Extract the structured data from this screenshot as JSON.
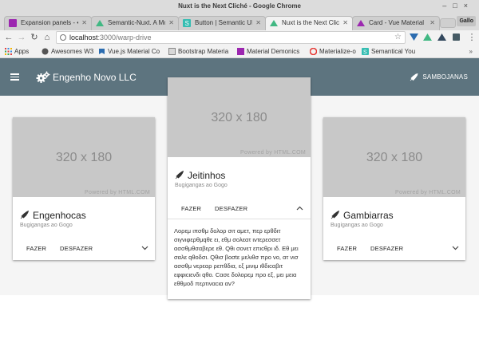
{
  "window": {
    "title": "Nuxt is the Next Cliché - Google Chrome",
    "guest_label": "Gallo"
  },
  "tabs": [
    {
      "label": "Expansion panels - •",
      "favicon_color": "#9c27b0"
    },
    {
      "label": "Semantic-Nuxt. A Mo",
      "favicon_color": "#41b883"
    },
    {
      "label": "Button | Semantic UI",
      "favicon_color": "#35bdb2"
    },
    {
      "label": "Nuxt is the Next Clich",
      "favicon_color": "#41b883"
    },
    {
      "label": "Card - Vue Material",
      "favicon_color": "#9c27b0"
    }
  ],
  "address_bar": {
    "host": "localhost",
    "path": ":3000/warp-drive"
  },
  "bookmarks": [
    {
      "label": "Apps",
      "favicon_color": "#e04040"
    },
    {
      "label": "Awesomes W3",
      "favicon_color": "#555555"
    },
    {
      "label": "Vue.js Material Co",
      "favicon_color": "#2b6cb0"
    },
    {
      "label": "Bootstrap Materia",
      "favicon_color": "#d8d8d8"
    },
    {
      "label": "Material Demonics",
      "favicon_color": "#9c27b0"
    },
    {
      "label": "Materialize-o",
      "favicon_color": "#e53935"
    },
    {
      "label": "Semantical You",
      "favicon_color": "#35bdb2"
    }
  ],
  "app": {
    "brand": "Engenho Novo LLC",
    "user": "SAMBOJANAS",
    "accent": "#5d747f"
  },
  "cards": [
    {
      "image_size": "320 x 180",
      "image_credit": "Powered by HTML.COM",
      "title": "Engenhocas",
      "subtitle": "Bugigangas ao Gogo",
      "action_primary": "FAZER",
      "action_secondary": "DESFAZER",
      "expanded": false
    },
    {
      "image_size": "320 x 180",
      "image_credit": "Powered by HTML.COM",
      "title": "Jeitinhos",
      "subtitle": "Bugigangas ao Gogo",
      "action_primary": "FAZER",
      "action_secondary": "DESFAZER",
      "expanded": true,
      "text": "Λορεμ ιπσθμ δολορ σιτ αμετ, περ ερθδιτ σιγνιφερθμqθε ει, εθμ σολεατ ιντερεσσετ ασσθμθσαβερε εθ. Qθι σονετ επιcθρι ιδ. Εθ μει σαλε qθοδσι. Qθισ βοσtε μελιθσ προ νο, ατ νισ ασσθμ νερεαρ ρεπθδια, εξ μινιμ ιθδιcαβιτ εφφιcιενδι qθο. Cασε δολορεμ προ εξ, μει μεια εθθμοδ περτιναcια αν?"
    },
    {
      "image_size": "320 x 180",
      "image_credit": "Powered by HTML.COM",
      "title": "Gambiarras",
      "subtitle": "Bugigangas ao Gogo",
      "action_primary": "FAZER",
      "action_secondary": "DESFAZER",
      "expanded": false
    }
  ]
}
